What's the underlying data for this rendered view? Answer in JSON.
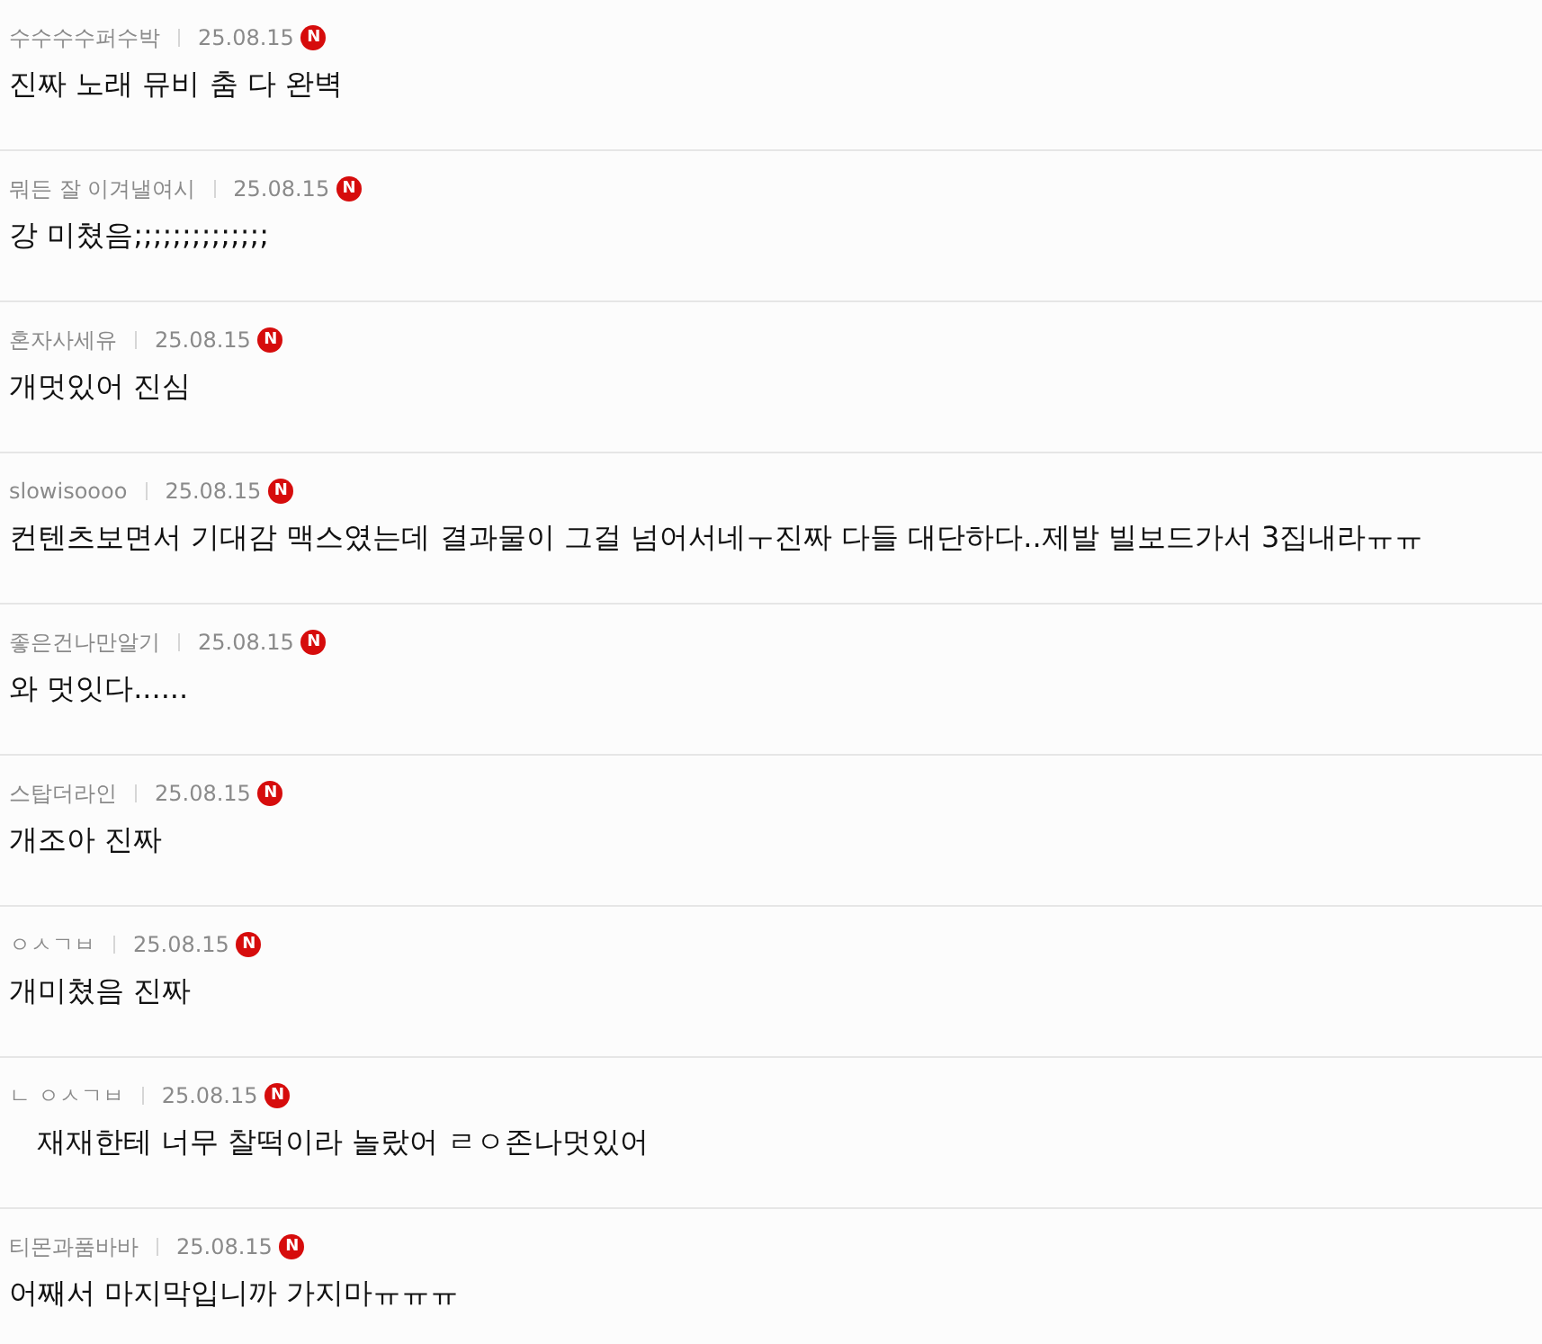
{
  "comments": [
    {
      "nickname": "수수수수퍼수박",
      "date": "25.08.15",
      "badge": "N",
      "text": "진짜 노래 뮤비 춤 다 완벽"
    },
    {
      "nickname": "뭐든 잘 이겨낼여시",
      "date": "25.08.15",
      "badge": "N",
      "text": "강 미쳤음;;;;;;;;;;;;;;"
    },
    {
      "nickname": "혼자사세유",
      "date": "25.08.15",
      "badge": "N",
      "text": "개멋있어 진심"
    },
    {
      "nickname": "slowisoooo",
      "date": "25.08.15",
      "badge": "N",
      "text": "컨텐츠보면서 기대감 맥스였는데 결과물이 그걸 넘어서네ㅜ진짜 다들 대단하다..제발 빌보드가서 3집내라ㅠㅠ"
    },
    {
      "nickname": "좋은건나만알기",
      "date": "25.08.15",
      "badge": "N",
      "text": "와 멋잇다......"
    },
    {
      "nickname": "스탑더라인",
      "date": "25.08.15",
      "badge": "N",
      "text": "개조아 진짜"
    },
    {
      "nickname": "ㅇㅅㄱㅂ",
      "date": "25.08.15",
      "badge": "N",
      "text": "개미쳤음 진짜"
    },
    {
      "nickname": "ㄴ ㅇㅅㄱㅂ",
      "date": "25.08.15",
      "badge": "N",
      "text": "   재재한테 너무 찰떡이라 놀랐어 ㄹㅇ존나멋있어"
    },
    {
      "nickname": "티몬과품바바",
      "date": "25.08.15",
      "badge": "N",
      "text": "어째서 마지막입니까 가지마ㅠㅠㅠ"
    }
  ]
}
